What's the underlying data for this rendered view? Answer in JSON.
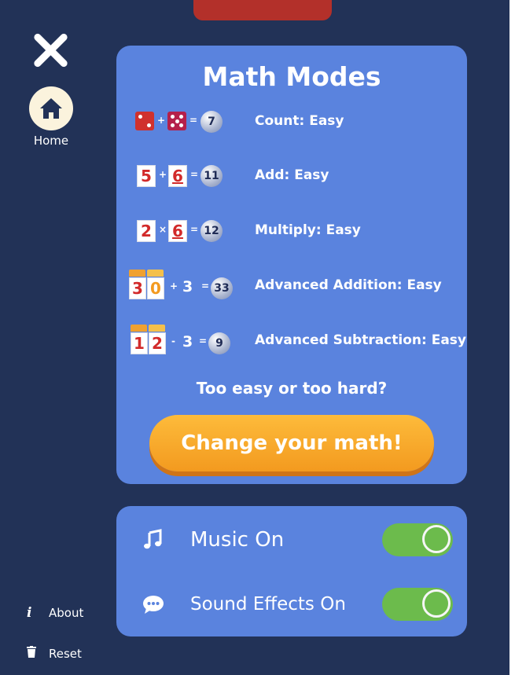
{
  "sidebar": {
    "home_label": "Home",
    "about_label": "About",
    "reset_label": "Reset"
  },
  "modes": {
    "title": "Math Modes",
    "items": [
      {
        "label": "Count: Easy",
        "result": "7"
      },
      {
        "label": "Add: Easy",
        "a": "5",
        "b": "6",
        "op": "+",
        "result": "11"
      },
      {
        "label": "Multiply: Easy",
        "a": "2",
        "b": "6",
        "op": "×",
        "result": "12"
      },
      {
        "label": "Advanced Addition: Easy",
        "d1": "3",
        "d2": "0",
        "op": "+",
        "n": "3",
        "result": "33"
      },
      {
        "label": "Advanced Subtraction: Easy",
        "d1": "1",
        "d2": "2",
        "op": "-",
        "n": "3",
        "result": "9"
      }
    ],
    "prompt": "Too easy or too hard?",
    "cta_label": "Change your math!"
  },
  "settings": {
    "music_label": "Music On",
    "music_on": true,
    "sfx_label": "Sound Effects On",
    "sfx_on": true
  },
  "colors": {
    "background": "#223257",
    "panel": "#5a83de",
    "accent_orange": "#f6a327",
    "toggle_green": "#6cbb4c",
    "die_red": "#d0312d",
    "die_magenta": "#b5204b"
  },
  "icons": [
    "close-icon",
    "home-icon",
    "info-icon",
    "trash-icon",
    "music-note-icon",
    "speech-bubble-icon"
  ]
}
